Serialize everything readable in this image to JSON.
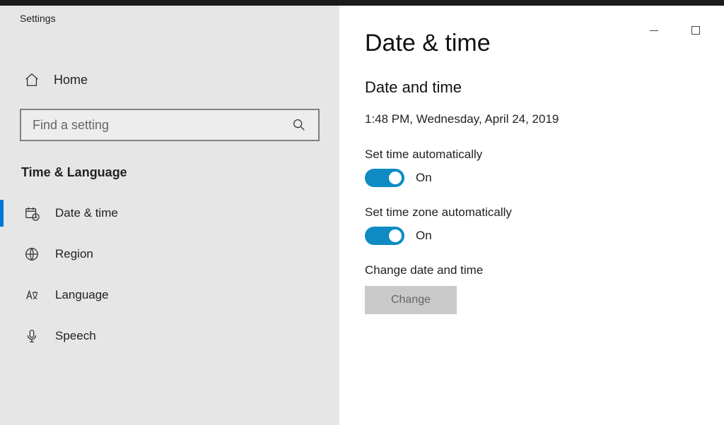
{
  "app_title": "Settings",
  "sidebar": {
    "home_label": "Home",
    "search_placeholder": "Find a setting",
    "section_label": "Time & Language",
    "items": [
      {
        "label": "Date & time",
        "active": true
      },
      {
        "label": "Region",
        "active": false
      },
      {
        "label": "Language",
        "active": false
      },
      {
        "label": "Speech",
        "active": false
      }
    ]
  },
  "main": {
    "page_title": "Date & time",
    "subheading": "Date and time",
    "current_datetime": "1:48 PM, Wednesday, April 24, 2019",
    "set_time_auto_label": "Set time automatically",
    "set_time_auto_state": "On",
    "set_tz_auto_label": "Set time zone automatically",
    "set_tz_auto_state": "On",
    "change_label": "Change date and time",
    "change_button": "Change"
  }
}
